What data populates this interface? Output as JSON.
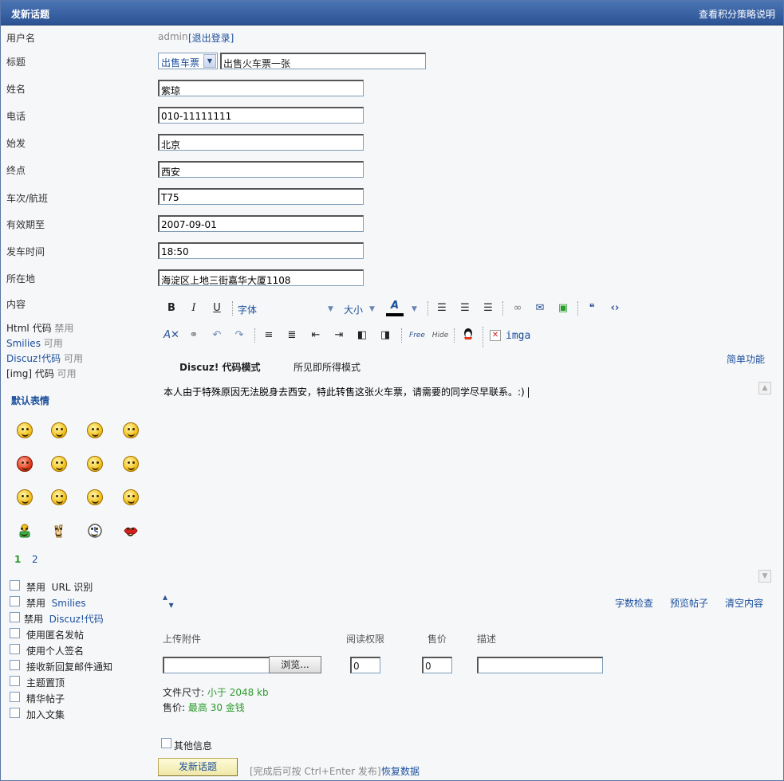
{
  "header": {
    "title": "发新话题",
    "right_link": "查看积分策略说明"
  },
  "user": {
    "label": "用户名",
    "name": "admin",
    "logout": "[退出登录]"
  },
  "subject": {
    "label": "标题",
    "type": "出售车票",
    "value": "出售火车票一张"
  },
  "fields": [
    {
      "label": "姓名",
      "value": "紫琼"
    },
    {
      "label": "电话",
      "value": "010-11111111"
    },
    {
      "label": "始发",
      "value": "北京"
    },
    {
      "label": "终点",
      "value": "西安"
    },
    {
      "label": "车次/航班",
      "value": "T75"
    },
    {
      "label": "有效期至",
      "value": "2007-09-01"
    },
    {
      "label": "发车时间",
      "value": "18:50"
    },
    {
      "label": "所在地",
      "value": "海淀区上地三街嘉华大厦1108"
    }
  ],
  "content": {
    "label": "内容"
  },
  "status": {
    "html_label": "Html 代码",
    "html_value": "禁用",
    "smilies_label": "Smilies",
    "smilies_value": "可用",
    "discuz_label": "Discuz!代码",
    "discuz_value": "可用",
    "img_label": "[img] 代码",
    "img_value": "可用"
  },
  "smilies": {
    "title": "默认表情",
    "pages": [
      "1",
      "2"
    ]
  },
  "options": [
    {
      "label": "禁用",
      "extra": "URL 识别",
      "extra_blue": false
    },
    {
      "label": "禁用",
      "extra": "Smilies",
      "extra_blue": true
    },
    {
      "label": "禁用",
      "extra": "Discuz!代码",
      "extra_blue": true
    },
    {
      "label": "使用匿名发帖",
      "extra": ""
    },
    {
      "label": "使用个人签名",
      "extra": ""
    },
    {
      "label": "接收新回复邮件通知",
      "extra": ""
    },
    {
      "label": "主题置顶",
      "extra": ""
    },
    {
      "label": "精华帖子",
      "extra": ""
    },
    {
      "label": "加入文集",
      "extra": ""
    }
  ],
  "toolbar": {
    "bold": "B",
    "italic": "I",
    "underline": "U",
    "font": "字体",
    "size": "大小",
    "color_glyph": "A",
    "img_label": "imga",
    "free_label": "Free",
    "hide_label": "Hide"
  },
  "modes": {
    "code_mode": "Discuz! 代码模式",
    "wysiwyg_mode": "所见即所得模式",
    "simple": "简单功能"
  },
  "editor": {
    "text": "本人由于特殊原因无法脱身去西安，特此转售这张火车票，请需要的同学尽早联系。:)"
  },
  "editor_actions": {
    "count": "字数检查",
    "preview": "预览帖子",
    "clear": "清空内容"
  },
  "attach": {
    "upload_label": "上传附件",
    "perm_label": "阅读权限",
    "price_label": "售价",
    "desc_label": "描述",
    "browse": "浏览...",
    "perm_value": "0",
    "price_value": "0",
    "size_label": "文件尺寸:",
    "size_value": "小于 2048 kb",
    "price_info_label": "售价:",
    "price_info_value": "最高 30 金钱"
  },
  "other_info": "其他信息",
  "submit": {
    "label": "发新话题",
    "hint": "[完成后可按 Ctrl+Enter 发布]",
    "restore": "恢复数据"
  },
  "colors": {
    "header_top": "#4b74b5",
    "header_bottom": "#2b5394",
    "link": "#1b4f9c",
    "green": "#2b9b2b"
  }
}
